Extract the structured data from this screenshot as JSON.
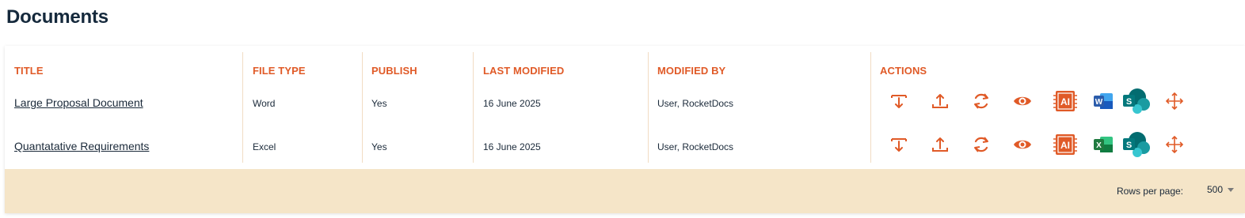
{
  "page": {
    "title": "Documents"
  },
  "table": {
    "columns": [
      "TITLE",
      "FILE TYPE",
      "PUBLISH",
      "LAST MODIFIED",
      "MODIFIED BY",
      "ACTIONS"
    ],
    "rows": [
      {
        "title": "Large Proposal Document",
        "file_type": "Word",
        "publish": "Yes",
        "last_modified": "16 June 2025",
        "modified_by": "User, RocketDocs",
        "app_icon": "word-icon"
      },
      {
        "title": "Quantatative Requirements",
        "file_type": "Excel",
        "publish": "Yes",
        "last_modified": "16 June 2025",
        "modified_by": "User, RocketDocs",
        "app_icon": "excel-icon"
      }
    ],
    "action_icons": [
      "download-icon",
      "upload-icon",
      "refresh-icon",
      "view-icon",
      "ai-icon",
      "app-icon",
      "sharepoint-icon",
      "move-icon"
    ],
    "colors": {
      "accent": "#e05a27",
      "footer_bg": "#f5e5c8",
      "word": "#2b5cab",
      "excel": "#1f7a3f",
      "sharepoint": "#0b7d78"
    }
  },
  "footer": {
    "rows_per_page_label": "Rows per page:",
    "rows_per_page_value": "500"
  }
}
